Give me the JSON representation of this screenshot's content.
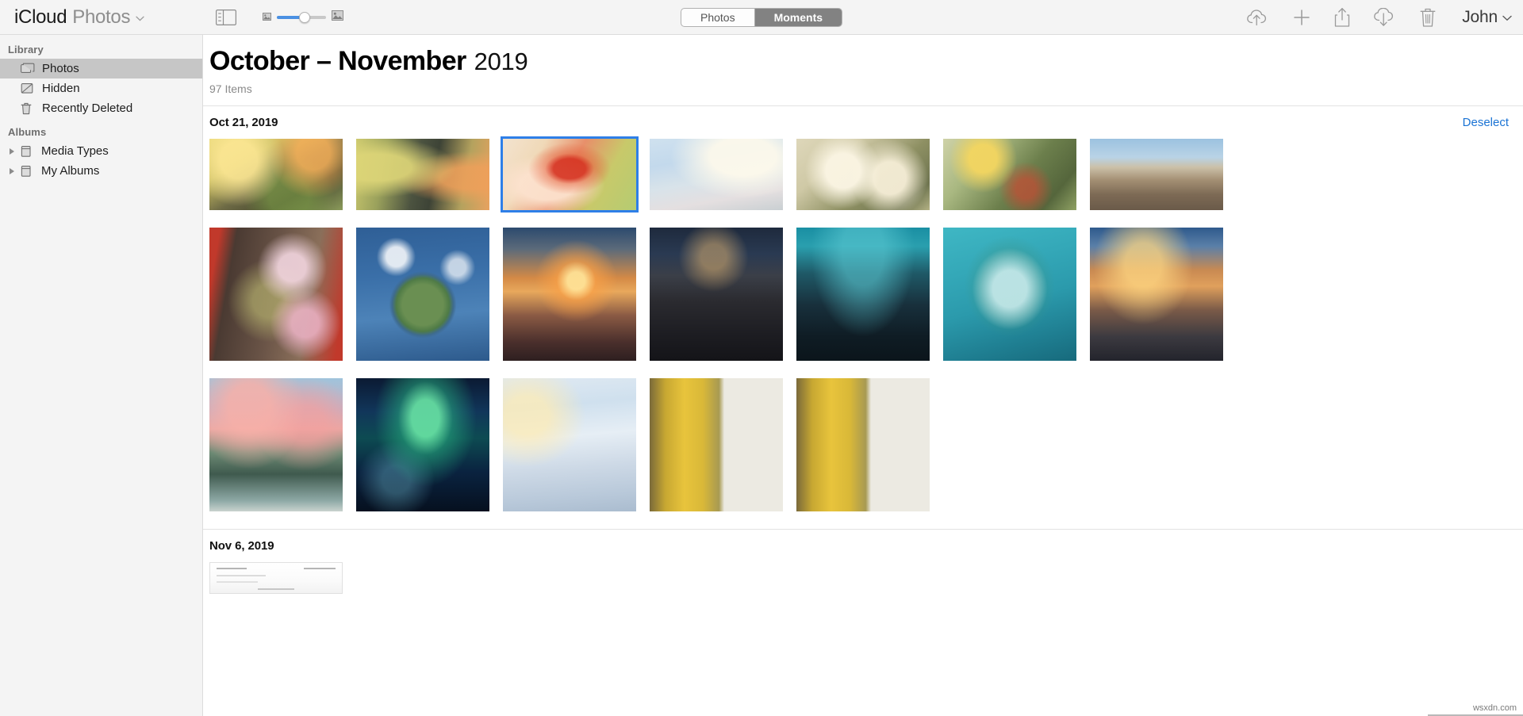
{
  "app": {
    "brand_primary": "iCloud",
    "brand_secondary": "Photos",
    "brand_caret": "⌄",
    "account_name": "John",
    "account_caret": "⌄"
  },
  "toolbar": {
    "sidebar_toggle_icon": "sidebar-toggle-icon",
    "zoom_small_icon": "small-thumbnail-icon",
    "zoom_large_icon": "large-thumbnail-icon",
    "zoom_value": 55,
    "icons": [
      {
        "name": "upload-to-icloud-icon",
        "label": "Upload"
      },
      {
        "name": "add-icon",
        "label": "Add"
      },
      {
        "name": "share-icon",
        "label": "Share"
      },
      {
        "name": "download-from-icloud-icon",
        "label": "Download"
      },
      {
        "name": "delete-icon",
        "label": "Delete"
      }
    ],
    "segmented": {
      "options": [
        "Photos",
        "Moments"
      ],
      "selected": "Moments"
    }
  },
  "sidebar": {
    "groups": [
      {
        "header": "Library",
        "items": [
          {
            "label": "Photos",
            "icon": "photos-stack-icon",
            "selected": true,
            "expandable": false
          },
          {
            "label": "Hidden",
            "icon": "hidden-slash-icon",
            "selected": false,
            "expandable": false
          },
          {
            "label": "Recently Deleted",
            "icon": "trash-icon",
            "selected": false,
            "expandable": false
          }
        ]
      },
      {
        "header": "Albums",
        "items": [
          {
            "label": "Media Types",
            "icon": "album-folder-icon",
            "selected": false,
            "expandable": true
          },
          {
            "label": "My Albums",
            "icon": "album-folder-icon",
            "selected": false,
            "expandable": true
          }
        ]
      }
    ]
  },
  "main": {
    "title_main": "October – November",
    "title_year": "2019",
    "item_count": "97 Items",
    "sections": [
      {
        "date": "Oct 21, 2019",
        "action_label": "Deselect",
        "rows": [
          {
            "shape": "landscape",
            "photos": [
              {
                "name": "photo-autumn-lantern",
                "selected": false
              },
              {
                "name": "photo-ivy-tree-maple",
                "selected": false
              },
              {
                "name": "photo-hand-red-maple-leaf",
                "selected": true
              },
              {
                "name": "photo-soft-blue-sky",
                "selected": false
              },
              {
                "name": "photo-white-roses",
                "selected": false
              },
              {
                "name": "photo-yellow-rose-bud",
                "selected": false
              },
              {
                "name": "photo-desert-highway",
                "selected": false
              }
            ]
          },
          {
            "shape": "square",
            "photos": [
              {
                "name": "photo-pink-blossom-red-wall",
                "selected": false
              },
              {
                "name": "photo-tiny-planet-castle",
                "selected": false
              },
              {
                "name": "photo-sunset-palm-street",
                "selected": false
              },
              {
                "name": "photo-night-city-crosswalk",
                "selected": false
              },
              {
                "name": "photo-teal-city-skyline-dusk",
                "selected": false
              },
              {
                "name": "photo-heart-shaped-island",
                "selected": false
              },
              {
                "name": "photo-eiffel-tower-sunset",
                "selected": false
              }
            ]
          },
          {
            "shape": "square",
            "photos": [
              {
                "name": "photo-pink-clouds-lake",
                "selected": false
              },
              {
                "name": "photo-green-aurora",
                "selected": false
              },
              {
                "name": "photo-snowy-forest-stream",
                "selected": false
              },
              {
                "name": "photo-yellow-ginkgo-wall-a",
                "selected": false
              },
              {
                "name": "photo-yellow-ginkgo-wall-b",
                "selected": false
              }
            ]
          }
        ]
      },
      {
        "date": "Nov 6, 2019",
        "action_label": "",
        "rows": [
          {
            "shape": "partial",
            "photos": [
              {
                "name": "photo-receipt-document",
                "selected": false
              }
            ]
          }
        ]
      }
    ]
  },
  "watermark": "wsxdn.com",
  "colors": {
    "accent_blue": "#1a73d4",
    "selection_blue": "#2e7fe8",
    "slider_blue": "#4a90e2",
    "toolbar_bg": "#f4f4f4",
    "sidebar_selected": "#c6c6c6"
  }
}
